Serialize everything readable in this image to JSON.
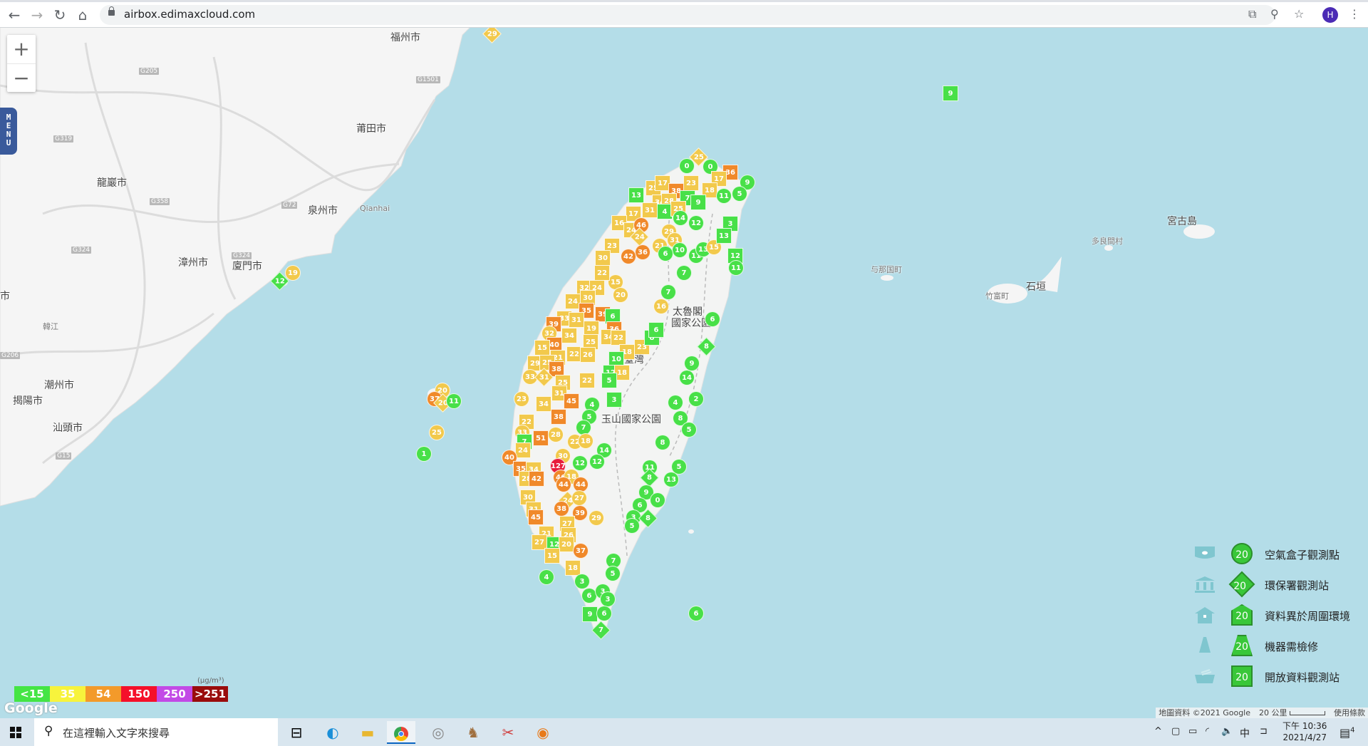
{
  "browser": {
    "url": "airbox.edimaxcloud.com",
    "profile_initial": "H"
  },
  "map": {
    "zoom_in": "+",
    "zoom_out": "−",
    "menu_label": "MENU",
    "cities": [
      "福州市",
      "莆田市",
      "龍巖市",
      "泉州市",
      "漳州市",
      "廈門市",
      "潮州市",
      "揭陽市",
      "汕頭市",
      "宮古島",
      "多良間村",
      "与那国町",
      "竹富町",
      "石垣",
      "太魯閣",
      "國家公園",
      "玉山國家公園",
      "臺灣",
      "市",
      "Qianhai",
      "韓江"
    ],
    "highways": [
      "G205",
      "G205",
      "G319",
      "G324",
      "G72",
      "G15",
      "G324",
      "G358",
      "G206",
      "G1501"
    ],
    "markers": [
      {
        "v": 25,
        "t": "diamond"
      },
      {
        "v": 0,
        "t": "circle"
      },
      {
        "v": 0,
        "t": "circle"
      },
      {
        "v": 36,
        "t": "square"
      },
      {
        "v": 17,
        "t": "square"
      },
      {
        "v": 9,
        "t": "circle"
      },
      {
        "v": 25,
        "t": "square"
      },
      {
        "v": 17,
        "t": "square"
      },
      {
        "v": 23,
        "t": "square"
      },
      {
        "v": 38,
        "t": "square"
      },
      {
        "v": 18,
        "t": "square"
      },
      {
        "v": 13,
        "t": "square"
      },
      {
        "v": 7,
        "t": "square"
      },
      {
        "v": 9,
        "t": "square"
      },
      {
        "v": 11,
        "t": "circle"
      },
      {
        "v": 5,
        "t": "circle"
      },
      {
        "v": 34,
        "t": "square"
      },
      {
        "v": 28,
        "t": "square"
      },
      {
        "v": 31,
        "t": "square"
      },
      {
        "v": 4,
        "t": "square"
      },
      {
        "v": 25,
        "t": "square"
      },
      {
        "v": 14,
        "t": "circle"
      },
      {
        "v": 12,
        "t": "circle"
      },
      {
        "v": 17,
        "t": "square"
      },
      {
        "v": 16,
        "t": "square"
      },
      {
        "v": 24,
        "t": "square"
      },
      {
        "v": 46,
        "t": "circle"
      },
      {
        "v": 24,
        "t": "diamond"
      },
      {
        "v": 29,
        "t": "circle"
      },
      {
        "v": 21,
        "t": "circle"
      },
      {
        "v": 31,
        "t": "circle"
      },
      {
        "v": 10,
        "t": "circle"
      },
      {
        "v": 6,
        "t": "circle"
      },
      {
        "v": 36,
        "t": "circle"
      },
      {
        "v": 42,
        "t": "circle"
      },
      {
        "v": 23,
        "t": "square"
      },
      {
        "v": 30,
        "t": "square"
      },
      {
        "v": 11,
        "t": "circle"
      },
      {
        "v": 13,
        "t": "circle"
      },
      {
        "v": 15,
        "t": "circle"
      },
      {
        "v": 3,
        "t": "square"
      },
      {
        "v": 13,
        "t": "square"
      },
      {
        "v": 12,
        "t": "square"
      },
      {
        "v": 11,
        "t": "circle"
      },
      {
        "v": 7,
        "t": "circle"
      },
      {
        "v": 15,
        "t": "circle"
      },
      {
        "v": 22,
        "t": "square"
      },
      {
        "v": 32,
        "t": "square"
      },
      {
        "v": 24,
        "t": "square"
      },
      {
        "v": 20,
        "t": "circle"
      },
      {
        "v": 30,
        "t": "square"
      },
      {
        "v": 24,
        "t": "square"
      },
      {
        "v": 35,
        "t": "square"
      },
      {
        "v": 39,
        "t": "square"
      },
      {
        "v": 6,
        "t": "square"
      },
      {
        "v": 33,
        "t": "square"
      },
      {
        "v": 31,
        "t": "square"
      },
      {
        "v": 39,
        "t": "square"
      },
      {
        "v": 19,
        "t": "square"
      },
      {
        "v": 36,
        "t": "square"
      },
      {
        "v": 34,
        "t": "square"
      },
      {
        "v": 34,
        "t": "square"
      },
      {
        "v": 22,
        "t": "square"
      },
      {
        "v": 32,
        "t": "circle"
      },
      {
        "v": 25,
        "t": "square"
      },
      {
        "v": 40,
        "t": "square"
      },
      {
        "v": 15,
        "t": "square"
      },
      {
        "v": 22,
        "t": "square"
      },
      {
        "v": 26,
        "t": "square"
      },
      {
        "v": 18,
        "t": "square"
      },
      {
        "v": 23,
        "t": "square"
      },
      {
        "v": 8,
        "t": "square"
      },
      {
        "v": 6,
        "t": "square"
      },
      {
        "v": 16,
        "t": "circle"
      },
      {
        "v": 7,
        "t": "circle"
      },
      {
        "v": 6,
        "t": "circle"
      },
      {
        "v": 8,
        "t": "diamond"
      },
      {
        "v": 9,
        "t": "circle"
      },
      {
        "v": 14,
        "t": "circle"
      },
      {
        "v": 2,
        "t": "circle"
      },
      {
        "v": 4,
        "t": "circle"
      },
      {
        "v": 8,
        "t": "circle"
      },
      {
        "v": 5,
        "t": "circle"
      },
      {
        "v": 8,
        "t": "circle"
      },
      {
        "v": 10,
        "t": "square"
      },
      {
        "v": 21,
        "t": "square"
      },
      {
        "v": 29,
        "t": "square"
      },
      {
        "v": 25,
        "t": "square"
      },
      {
        "v": 38,
        "t": "square"
      },
      {
        "v": 12,
        "t": "square"
      },
      {
        "v": 18,
        "t": "square"
      },
      {
        "v": 33,
        "t": "circle"
      },
      {
        "v": 31,
        "t": "diamond"
      },
      {
        "v": 25,
        "t": "square"
      },
      {
        "v": 22,
        "t": "square"
      },
      {
        "v": 5,
        "t": "square"
      },
      {
        "v": 31,
        "t": "square"
      },
      {
        "v": 23,
        "t": "circle"
      },
      {
        "v": 34,
        "t": "square"
      },
      {
        "v": 45,
        "t": "square"
      },
      {
        "v": 3,
        "t": "square"
      },
      {
        "v": 4,
        "t": "circle"
      },
      {
        "v": 38,
        "t": "square"
      },
      {
        "v": 22,
        "t": "square"
      },
      {
        "v": 5,
        "t": "circle"
      },
      {
        "v": 7,
        "t": "circle"
      },
      {
        "v": 33,
        "t": "circle"
      },
      {
        "v": 51,
        "t": "square"
      },
      {
        "v": 28,
        "t": "circle"
      },
      {
        "v": 22,
        "t": "circle"
      },
      {
        "v": 18,
        "t": "circle"
      },
      {
        "v": 7,
        "t": "square"
      },
      {
        "v": 24,
        "t": "square"
      },
      {
        "v": 30,
        "t": "circle"
      },
      {
        "v": 14,
        "t": "circle"
      },
      {
        "v": 12,
        "t": "circle"
      },
      {
        "v": 12,
        "t": "circle"
      },
      {
        "v": 127,
        "t": "circle"
      },
      {
        "v": 40,
        "t": "circle"
      },
      {
        "v": 35,
        "t": "square"
      },
      {
        "v": 34,
        "t": "square"
      },
      {
        "v": 46,
        "t": "circle"
      },
      {
        "v": 18,
        "t": "circle"
      },
      {
        "v": 44,
        "t": "circle"
      },
      {
        "v": 44,
        "t": "circle"
      },
      {
        "v": 28,
        "t": "square"
      },
      {
        "v": 42,
        "t": "square"
      },
      {
        "v": 30,
        "t": "square"
      },
      {
        "v": 24,
        "t": "diamond"
      },
      {
        "v": 27,
        "t": "circle"
      },
      {
        "v": 38,
        "t": "circle"
      },
      {
        "v": 39,
        "t": "circle"
      },
      {
        "v": 29,
        "t": "circle"
      },
      {
        "v": 31,
        "t": "square"
      },
      {
        "v": 45,
        "t": "square"
      },
      {
        "v": 27,
        "t": "square"
      },
      {
        "v": 21,
        "t": "square"
      },
      {
        "v": 26,
        "t": "square"
      },
      {
        "v": 27,
        "t": "square"
      },
      {
        "v": 12,
        "t": "square"
      },
      {
        "v": 20,
        "t": "square"
      },
      {
        "v": 37,
        "t": "circle"
      },
      {
        "v": 15,
        "t": "square"
      },
      {
        "v": 18,
        "t": "square"
      },
      {
        "v": 4,
        "t": "circle"
      },
      {
        "v": 3,
        "t": "circle"
      },
      {
        "v": 6,
        "t": "circle"
      },
      {
        "v": 3,
        "t": "circle"
      },
      {
        "v": 3,
        "t": "circle"
      },
      {
        "v": 9,
        "t": "square"
      },
      {
        "v": 6,
        "t": "circle"
      },
      {
        "v": 7,
        "t": "diamond"
      },
      {
        "v": 7,
        "t": "circle"
      },
      {
        "v": 5,
        "t": "circle"
      },
      {
        "v": 6,
        "t": "circle"
      },
      {
        "v": 11,
        "t": "circle"
      },
      {
        "v": 5,
        "t": "circle"
      },
      {
        "v": 8,
        "t": "diamond"
      },
      {
        "v": 13,
        "t": "circle"
      },
      {
        "v": 9,
        "t": "circle"
      },
      {
        "v": 0,
        "t": "circle"
      },
      {
        "v": 6,
        "t": "circle"
      },
      {
        "v": 3,
        "t": "circle"
      },
      {
        "v": 8,
        "t": "diamond"
      },
      {
        "v": 5,
        "t": "circle"
      },
      {
        "v": 12,
        "t": "diamond"
      },
      {
        "v": 19,
        "t": "circle"
      },
      {
        "v": 20,
        "t": "circle"
      },
      {
        "v": 37,
        "t": "circle"
      },
      {
        "v": 20,
        "t": "diamond"
      },
      {
        "v": 11,
        "t": "circle"
      },
      {
        "v": 25,
        "t": "circle"
      },
      {
        "v": 1,
        "t": "circle"
      },
      {
        "v": 29,
        "t": "diamond"
      },
      {
        "v": 9,
        "t": "square"
      }
    ]
  },
  "legend": {
    "badge_value": "20",
    "items": [
      {
        "label": "空氣盒子觀測點",
        "icon": "airbox-icon"
      },
      {
        "label": "環保署觀測站",
        "icon": "government-building-icon"
      },
      {
        "label": "資料異於周圍環境",
        "icon": "house-icon"
      },
      {
        "label": "機器需檢修",
        "icon": "traffic-cone-icon"
      },
      {
        "label": "開放資料觀測站",
        "icon": "open-data-icon"
      }
    ]
  },
  "pm_scale": {
    "unit": "(μg/m³)",
    "levels": [
      {
        "label": "<15",
        "color": "#44e544"
      },
      {
        "label": "35",
        "color": "#f7f33c"
      },
      {
        "label": "54",
        "color": "#f39a2a"
      },
      {
        "label": "150",
        "color": "#f5102a"
      },
      {
        "label": "250",
        "color": "#c24ae6"
      },
      {
        "label": ">251",
        "color": "#9a0c0c"
      }
    ]
  },
  "marker_colors": {
    "good": "#48e048",
    "moderate": "#f2c94c",
    "usg": "#f0892a",
    "unhealthy": "#e81c3c"
  },
  "attribution": {
    "data": "地圖資料 ©2021 Google",
    "scale": "20 公里",
    "terms": "使用條款",
    "logo": "Google"
  },
  "taskbar": {
    "search_placeholder": "在這裡輸入文字來搜尋",
    "ime": "中",
    "time": "下午 10:36",
    "date": "2021/4/27",
    "notifications": "4"
  }
}
